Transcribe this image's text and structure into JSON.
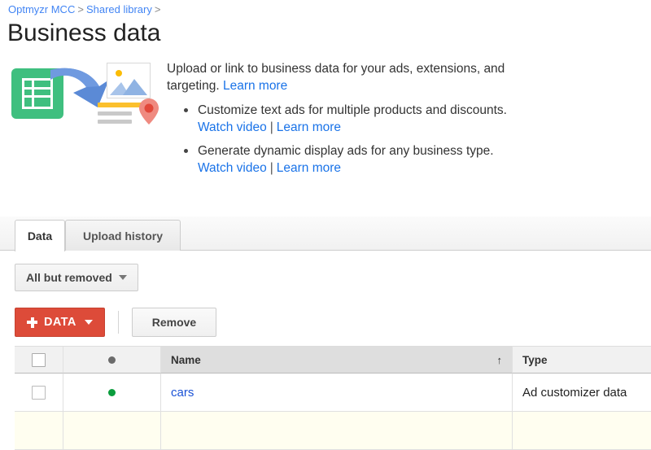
{
  "breadcrumb": {
    "items": [
      "Optmyzr MCC",
      "Shared library"
    ],
    "separator": ">"
  },
  "page_title": "Business data",
  "promo": {
    "intro": "Upload or link to business data for your ads, extensions, and targeting.",
    "intro_link": "Learn more",
    "bullets": [
      {
        "text": "Customize text ads for multiple products and discounts.",
        "watch_video": "Watch video",
        "divider": "|",
        "learn_more": "Learn more"
      },
      {
        "text": "Generate dynamic display ads for any business type.",
        "watch_video": "Watch video",
        "divider": "|",
        "learn_more": "Learn more"
      }
    ],
    "icons": {
      "sheet": "spreadsheet-icon",
      "arrow": "curved-arrow-icon",
      "image": "image-placeholder-icon",
      "pin": "map-pin-icon"
    }
  },
  "tabs": [
    {
      "label": "Data",
      "active": true
    },
    {
      "label": "Upload history",
      "active": false
    }
  ],
  "filter": {
    "label": "All but removed",
    "caret": "chevron-down-icon"
  },
  "toolbar": {
    "add_data_label": "DATA",
    "add_icon": "plus-icon",
    "add_caret": "chevron-down-icon",
    "remove_label": "Remove",
    "accent_color": "#dd4b39"
  },
  "table": {
    "columns": [
      {
        "key": "check",
        "label": ""
      },
      {
        "key": "status",
        "label": ""
      },
      {
        "key": "name",
        "label": "Name",
        "sorted": true,
        "sort_dir": "ascending",
        "sort_glyph": "↑"
      },
      {
        "key": "type",
        "label": "Type"
      }
    ],
    "rows": [
      {
        "status": "enabled",
        "status_color": "#0b9d3d",
        "name": "cars",
        "type": "Ad customizer data",
        "highlight": false
      },
      {
        "status": "",
        "status_color": "",
        "name": "",
        "type": "",
        "highlight": true
      }
    ]
  }
}
